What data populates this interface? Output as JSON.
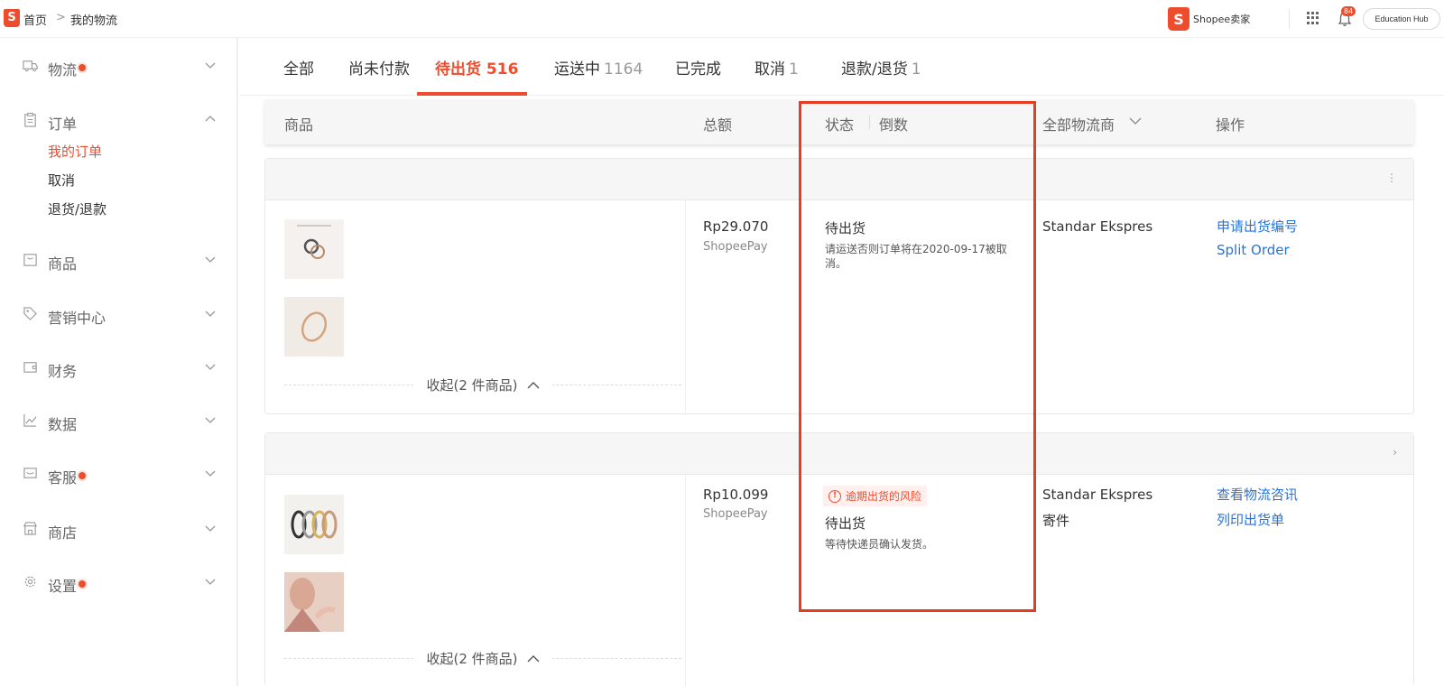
{
  "topbar": {
    "logo_letter": "S",
    "breadcrumb": {
      "home": "首页",
      "separator": ">",
      "current": "我的物流"
    },
    "brand": {
      "letter": "S",
      "text": "Shopee卖家"
    },
    "notification_count": "84",
    "education_hub": "Education Hub"
  },
  "sidebar": {
    "items": [
      {
        "label": "物流",
        "dot": true
      },
      {
        "label": "订单",
        "dot": false,
        "expanded": true
      },
      {
        "label": "商品",
        "dot": false
      },
      {
        "label": "营销中心",
        "dot": false
      },
      {
        "label": "财务",
        "dot": false
      },
      {
        "label": "数据",
        "dot": false
      },
      {
        "label": "客服",
        "dot": true
      },
      {
        "label": "商店",
        "dot": false
      },
      {
        "label": "设置",
        "dot": true
      }
    ],
    "order_sub": [
      "我的订单",
      "取消",
      "退货/退款"
    ]
  },
  "tabs": [
    {
      "label": "全部",
      "count": ""
    },
    {
      "label": "尚未付款",
      "count": ""
    },
    {
      "label": "待出货",
      "count": "516",
      "active": true
    },
    {
      "label": "运送中",
      "count": "1164"
    },
    {
      "label": "已完成",
      "count": ""
    },
    {
      "label": "取消",
      "count": "1"
    },
    {
      "label": "退款/退货",
      "count": "1"
    }
  ],
  "table_header": {
    "product": "商品",
    "total": "总额",
    "status": "状态",
    "countdown": "倒数",
    "carrier": "全部物流商",
    "action": "操作"
  },
  "orders": [
    {
      "amount": "Rp29.070",
      "payment": "ShopeePay",
      "collapse": "收起(2 件商品)",
      "status": "待出货",
      "status_desc": "请运送否则订单将在2020-09-17被取消。",
      "carrier": "Standar Ekspres",
      "actions": [
        "申请出货编号",
        "Split Order"
      ]
    },
    {
      "amount": "Rp10.099",
      "payment": "ShopeePay",
      "collapse": "收起(2 件商品)",
      "risk": "逾期出货的风险",
      "status": "待出货",
      "status_desc": "等待快递员确认发货。",
      "carrier": "Standar Ekspres",
      "carrier_sub": "寄件",
      "actions": [
        "查看物流咨讯",
        "列印出货单"
      ]
    }
  ],
  "colors": {
    "accent": "#ee4d2d",
    "link": "#2673dd",
    "highlight": "#e53d1f"
  }
}
